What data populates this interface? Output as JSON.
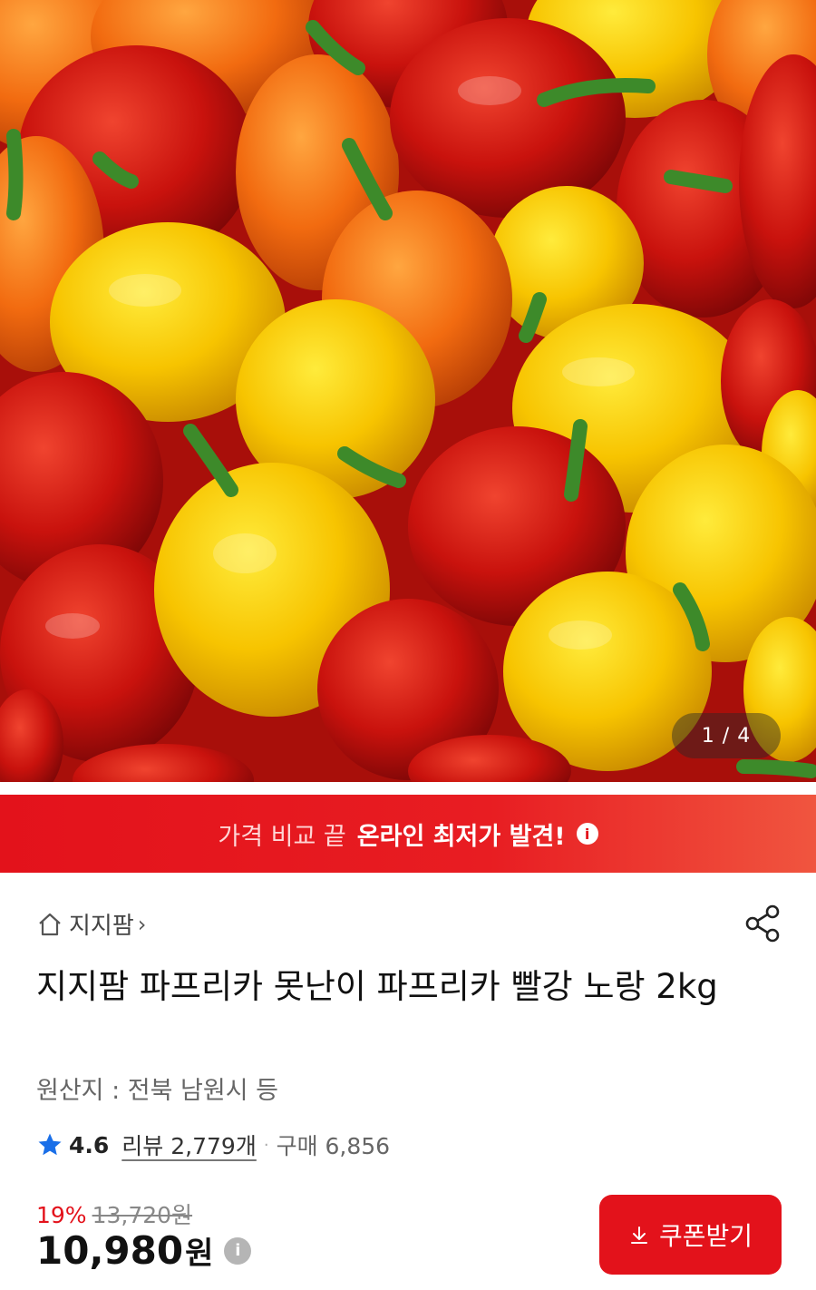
{
  "hero": {
    "pager_current": "1",
    "pager_total": "4",
    "pager_text": "1 / 4"
  },
  "promo": {
    "prefix": "가격 비교 끝",
    "highlight": "온라인 최저가 발견!",
    "info_icon": "info-icon"
  },
  "product": {
    "store": "지지팜",
    "title": "지지팜 파프리카 못난이 파프리카 빨강 노랑 2kg",
    "origin": "원산지 : 전북 남원시 등",
    "rating": "4.6",
    "review_label": "리뷰 2,779개",
    "purchase_label": "구매 6,856",
    "discount": "19%",
    "original_price": "13,720원",
    "price": "10,980",
    "currency": "원"
  },
  "actions": {
    "coupon_label": "쿠폰받기"
  },
  "colors": {
    "accent": "#e3121b",
    "star": "#1a6fe8"
  }
}
